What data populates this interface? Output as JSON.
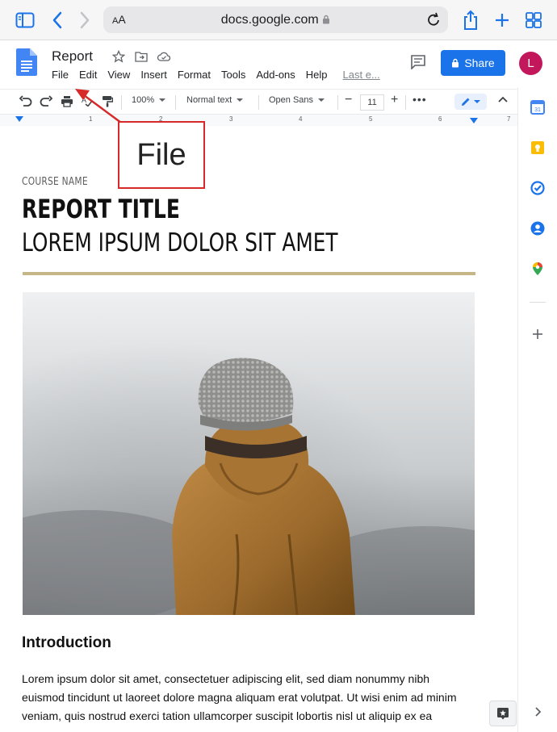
{
  "browser": {
    "aa_label_big": "A",
    "aa_label_small": "A",
    "url": "docs.google.com"
  },
  "docs": {
    "title": "Report",
    "menu": [
      "File",
      "Edit",
      "View",
      "Insert",
      "Format",
      "Tools",
      "Add-ons",
      "Help"
    ],
    "last_edit": "Last e...",
    "share_label": "Share",
    "avatar_initial": "L"
  },
  "toolbar": {
    "zoom": "100%",
    "style": "Normal text",
    "font": "Open Sans",
    "font_size": "11"
  },
  "ruler": {
    "numbers": [
      "1",
      "2",
      "3",
      "4",
      "5",
      "6",
      "7"
    ]
  },
  "document": {
    "course_name": "COURSE NAME",
    "report_title": "REPORT TITLE",
    "subtitle": "LOREM IPSUM DOLOR SIT AMET",
    "intro_heading": "Introduction",
    "paragraph": "Lorem ipsum dolor sit amet, consectetuer adipiscing elit, sed diam nonummy nibh euismod tincidunt ut laoreet dolore magna aliquam erat volutpat. Ut wisi enim ad minim veniam, quis nostrud exerci tation ullamcorper suscipit lobortis nisl ut aliquip ex ea"
  },
  "annotation": {
    "callout_text": "File"
  },
  "colors": {
    "share_blue": "#1a73e8",
    "avatar": "#c2185b",
    "callout_red": "#d62a2a",
    "gold_rule": "#c6b587"
  }
}
